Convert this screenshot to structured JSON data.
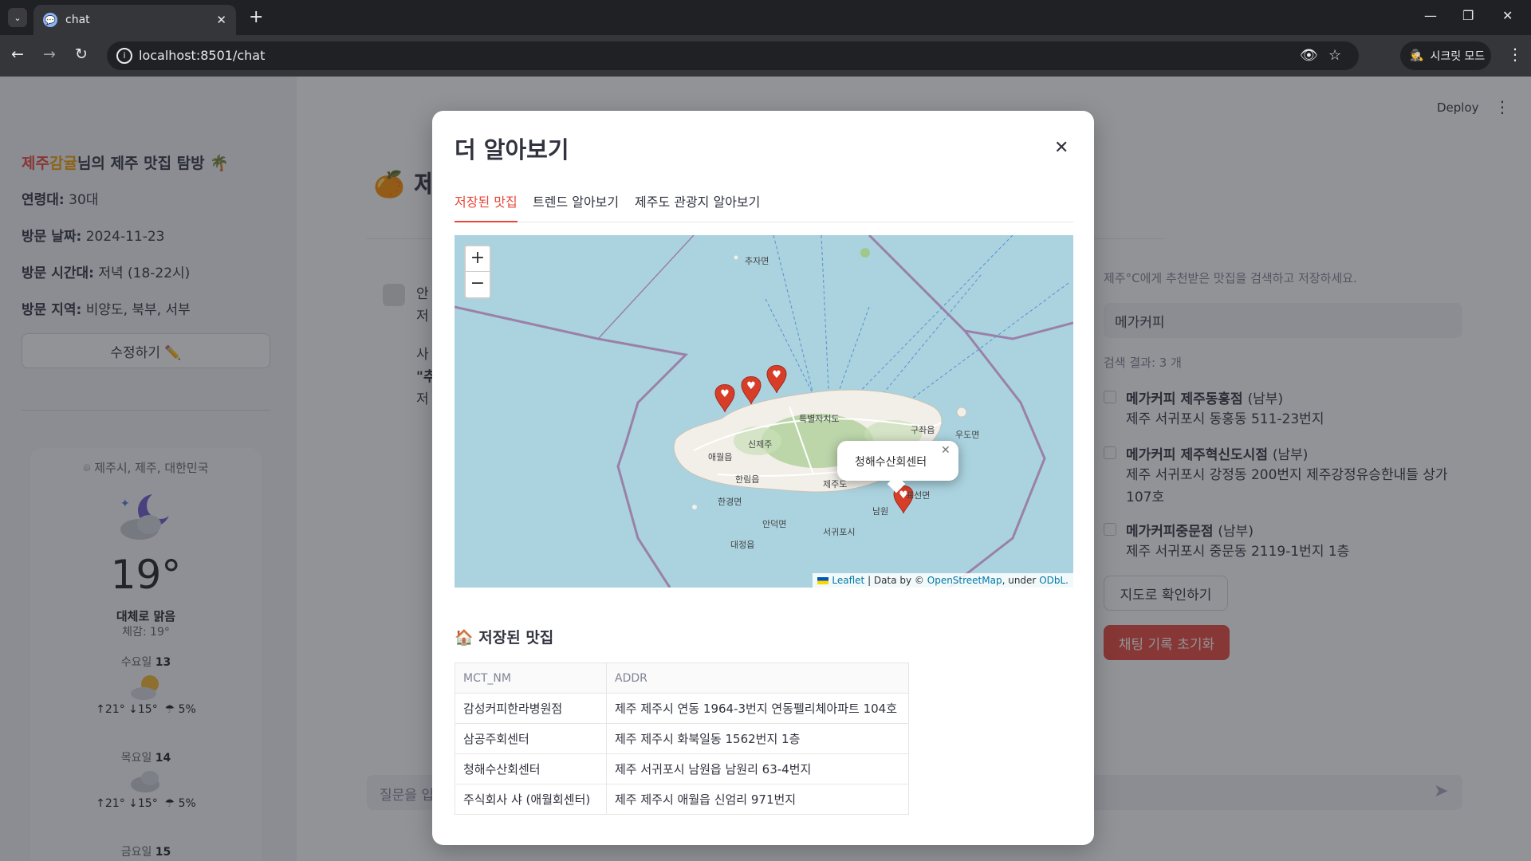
{
  "browser": {
    "tab_title": "chat",
    "url": "localhost:8501/chat",
    "incognito_label": "시크릿 모드"
  },
  "sidebar": {
    "title_part1": "제주",
    "title_part2": "감귤",
    "title_suffix": "님의 제주 맛집 탐방 🌴",
    "age_label": "연령대:",
    "age_value": "30대",
    "date_label": "방문 날짜:",
    "date_value": "2024-11-23",
    "time_label": "방문 시간대:",
    "time_value": "저녁 (18-22시)",
    "region_label": "방문 지역:",
    "region_value": "비양도, 북부, 서부",
    "edit_button": "수정하기 ✏️"
  },
  "weather": {
    "location": "제주시, 제주, 대한민국",
    "temperature": "19°",
    "description": "대체로 맑음",
    "feels_like": "체감: 19°",
    "days": [
      {
        "name": "수요일",
        "date": "13",
        "range": "↑21° ↓15°",
        "rain": "5%"
      },
      {
        "name": "목요일",
        "date": "14",
        "range": "↑21° ↓15°",
        "rain": "5%"
      },
      {
        "name": "금요일",
        "date": "15"
      }
    ]
  },
  "main": {
    "title": "🍊 제주",
    "chat_line1": "안",
    "chat_line2": "저",
    "chat_line3": "사",
    "chat_line4": "\"추",
    "chat_line5": "저",
    "chat_input_placeholder": "질문을 입",
    "deploy_label": "Deploy"
  },
  "right_panel": {
    "hint": "제주°C에게 추천받은 맛집을 검색하고 저장하세요.",
    "search_value": "메가커피",
    "count": "검색 결과: 3 개",
    "results": [
      {
        "name": "메가커피 제주동홍점",
        "region": "(남부)",
        "addr": "제주 서귀포시 동홍동 511-23번지"
      },
      {
        "name": "메가커피 제주혁신도시점",
        "region": "(남부)",
        "addr": "제주 서귀포시 강정동 200번지 제주강정유승한내들 상가 107호"
      },
      {
        "name": "메가커피중문점",
        "region": "(남부)",
        "addr": "제주 서귀포시 중문동 2119-1번지 1층"
      }
    ],
    "map_button": "지도로 확인하기",
    "reset_button": "채팅 기록 초기화"
  },
  "modal": {
    "title": "더 알아보기",
    "tabs": [
      "저장된 맛집",
      "트렌드 알아보기",
      "제주도 관광지 알아보기"
    ],
    "map": {
      "zoom_in": "+",
      "zoom_out": "−",
      "popup_text": "청해수산회센터",
      "attribution_leaflet": "Leaflet",
      "attribution_mid": " | Data by © ",
      "attribution_osm": "OpenStreetMap",
      "attribution_under": ", under ",
      "attribution_odbl": "ODbL.",
      "labels": [
        "추자면",
        "애월읍",
        "신제주",
        "특별자치도",
        "구좌읍",
        "우도면",
        "한림읍",
        "제주도",
        "한경면",
        "남원",
        "표선면",
        "안덕면",
        "서귀포시",
        "대정읍"
      ]
    },
    "saved_title": "🏠 저장된 맛집",
    "table": {
      "headers": [
        "MCT_NM",
        "ADDR"
      ],
      "rows": [
        [
          "감성커피한라병원점",
          "제주 제주시 연동 1964-3번지 연동펠리체아파트 104호"
        ],
        [
          "삼공주회센터",
          "제주 제주시 화북일동 1562번지 1층"
        ],
        [
          "청해수산회센터",
          "제주 서귀포시 남원읍 남원리 63-4번지"
        ],
        [
          "주식회사 샤 (애월회센터)",
          "제주 제주시 애월읍 신엄리 971번지"
        ]
      ]
    }
  }
}
